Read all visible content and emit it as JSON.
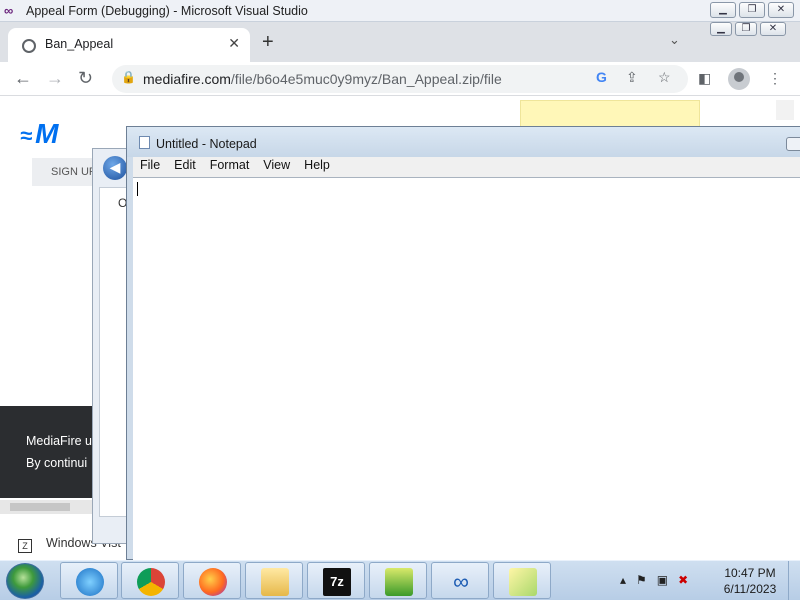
{
  "vs_window": {
    "title": "Appeal Form (Debugging) - Microsoft Visual Studio"
  },
  "browser": {
    "tab_title": "Ban_Appeal",
    "url_host": "mediafire.com",
    "url_path": "/file/b6o4e5muc0y9myz/Ban_Appeal.zip/file"
  },
  "page": {
    "logo": "M",
    "signup": "SIGN UP",
    "banner_line1": "MediaFire u",
    "banner_line2": "By continui",
    "windows_vista": "Windows Vist",
    "explorer_tab": "O"
  },
  "notepad": {
    "title": "Untitled - Notepad",
    "menus": [
      "File",
      "Edit",
      "Format",
      "View",
      "Help"
    ],
    "content": ""
  },
  "taskbar": {
    "apps": [
      "internet-explorer",
      "chrome",
      "firefox",
      "file-explorer",
      "7-zip",
      "checklist-app",
      "visual-studio",
      "sticky-notes"
    ],
    "time": "10:47 PM",
    "date": "6/11/2023"
  }
}
